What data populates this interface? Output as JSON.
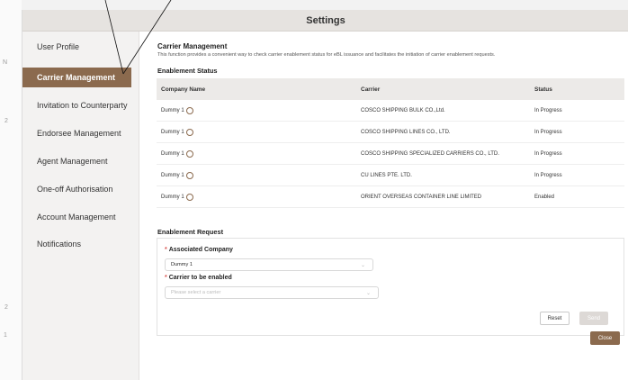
{
  "window": {
    "title": "Settings"
  },
  "sidebar": {
    "items": [
      {
        "label": "User Profile",
        "active": false
      },
      {
        "label": "Carrier Management",
        "active": true
      },
      {
        "label": "Invitation to Counterparty",
        "active": false
      },
      {
        "label": "Endorsee Management",
        "active": false
      },
      {
        "label": "Agent Management",
        "active": false
      },
      {
        "label": "One-off Authorisation",
        "active": false
      },
      {
        "label": "Account Management",
        "active": false
      },
      {
        "label": "Notifications",
        "active": false
      }
    ]
  },
  "main": {
    "title": "Carrier Management",
    "description": "This function provides a convenient way to check carrier enablement status for eBL issuance and facilitates the initiation of carrier enablement requests.",
    "status_title": "Enablement Status",
    "table": {
      "headers": [
        "Company Name",
        "Carrier",
        "Status"
      ],
      "rows": [
        {
          "company": "Dummy 1",
          "carrier": "COSCO SHIPPING BULK CO.,Ltd.",
          "status": "In Progress"
        },
        {
          "company": "Dummy 1",
          "carrier": "COSCO SHIPPING LINES CO., LTD.",
          "status": "In Progress"
        },
        {
          "company": "Dummy 1",
          "carrier": "COSCO SHIPPING SPECIALIZED CARRIERS CO., LTD.",
          "status": "In Progress"
        },
        {
          "company": "Dummy 1",
          "carrier": "CU LINES PTE. LTD.",
          "status": "In Progress"
        },
        {
          "company": "Dummy 1",
          "carrier": "ORIENT OVERSEAS CONTAINER LINE LIMITED",
          "status": "Enabled"
        }
      ]
    },
    "request": {
      "title": "Enablement Request",
      "associated_company_label": "Associated Company",
      "associated_company_value": "Dummy 1",
      "carrier_label": "Carrier to be enabled",
      "carrier_placeholder": "Please select a carrier",
      "reset_label": "Reset",
      "send_label": "Send"
    },
    "close_label": "Close"
  },
  "colors": {
    "accent": "#8b6a4e",
    "header_bg": "#e6e3e0",
    "required": "#d9534f"
  },
  "background_marks": [
    "N",
    "2",
    "2",
    "1"
  ]
}
